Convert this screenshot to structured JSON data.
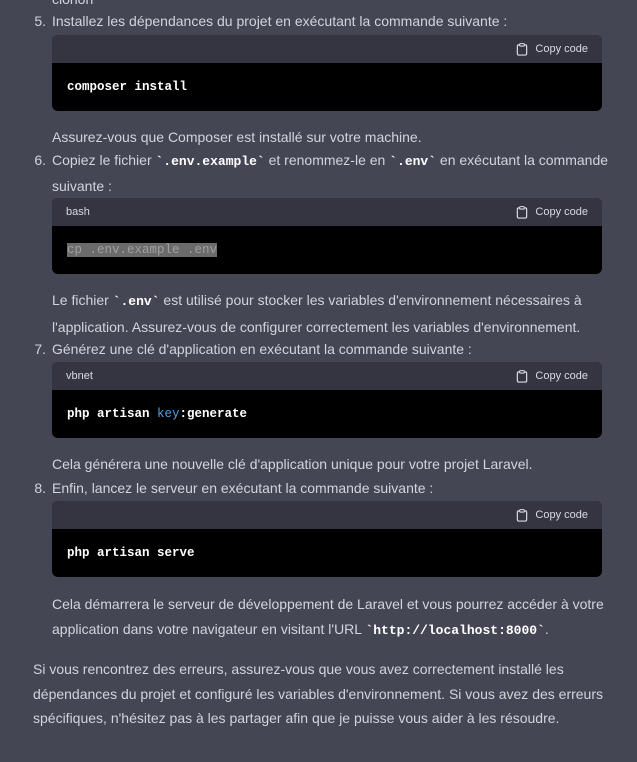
{
  "top_cut_text": "clonon",
  "copy_label": "Copy code",
  "steps": [
    {
      "num": "5.",
      "text_pre": "Installez les dépendances du projet en exécutant la commande suivante :"
    },
    {
      "num": "6.",
      "text_pre": "Copiez le fichier ",
      "code1": "`.env.example`",
      "text_mid": " et renommez-le en ",
      "code2": "`.env`",
      "text_post": " en exécutant la commande suivante :"
    },
    {
      "num": "7.",
      "text_pre": "Générez une clé d'application en exécutant la commande suivante :"
    },
    {
      "num": "8.",
      "text_pre": "Enfin, lancez le serveur en exécutant la commande suivante :"
    }
  ],
  "code_blocks": [
    {
      "lang": "",
      "code": "composer install"
    },
    {
      "lang": "bash",
      "code": "cp .env.example .env"
    },
    {
      "lang": "vbnet",
      "code_a": "php artisan ",
      "code_kw": "key",
      "code_b": ":generate"
    },
    {
      "lang": "",
      "code": "php artisan serve"
    }
  ],
  "notes": {
    "after_5": "Assurez-vous que Composer est installé sur votre machine.",
    "after_6_pre": "Le fichier ",
    "after_6_code": "`.env`",
    "after_6_post": " est utilisé pour stocker les variables d'environnement nécessaires à l'application. Assurez-vous de configurer correctement les variables d'environnement.",
    "after_7": "Cela générera une nouvelle clé d'application unique pour votre projet Laravel.",
    "after_8_pre": "Cela démarrera le serveur de développement de Laravel et vous pourrez accéder à votre application dans votre navigateur en visitant l'URL ",
    "after_8_code": "`http://localhost:8000`",
    "after_8_post": "."
  },
  "final_paragraph": "Si vous rencontrez des erreurs, assurez-vous que vous avez correctement installé les dépendances du projet et configuré les variables d'environnement. Si vous avez des erreurs spécifiques, n'hésitez pas à les partager afin que je puisse vous aider à les résoudre."
}
